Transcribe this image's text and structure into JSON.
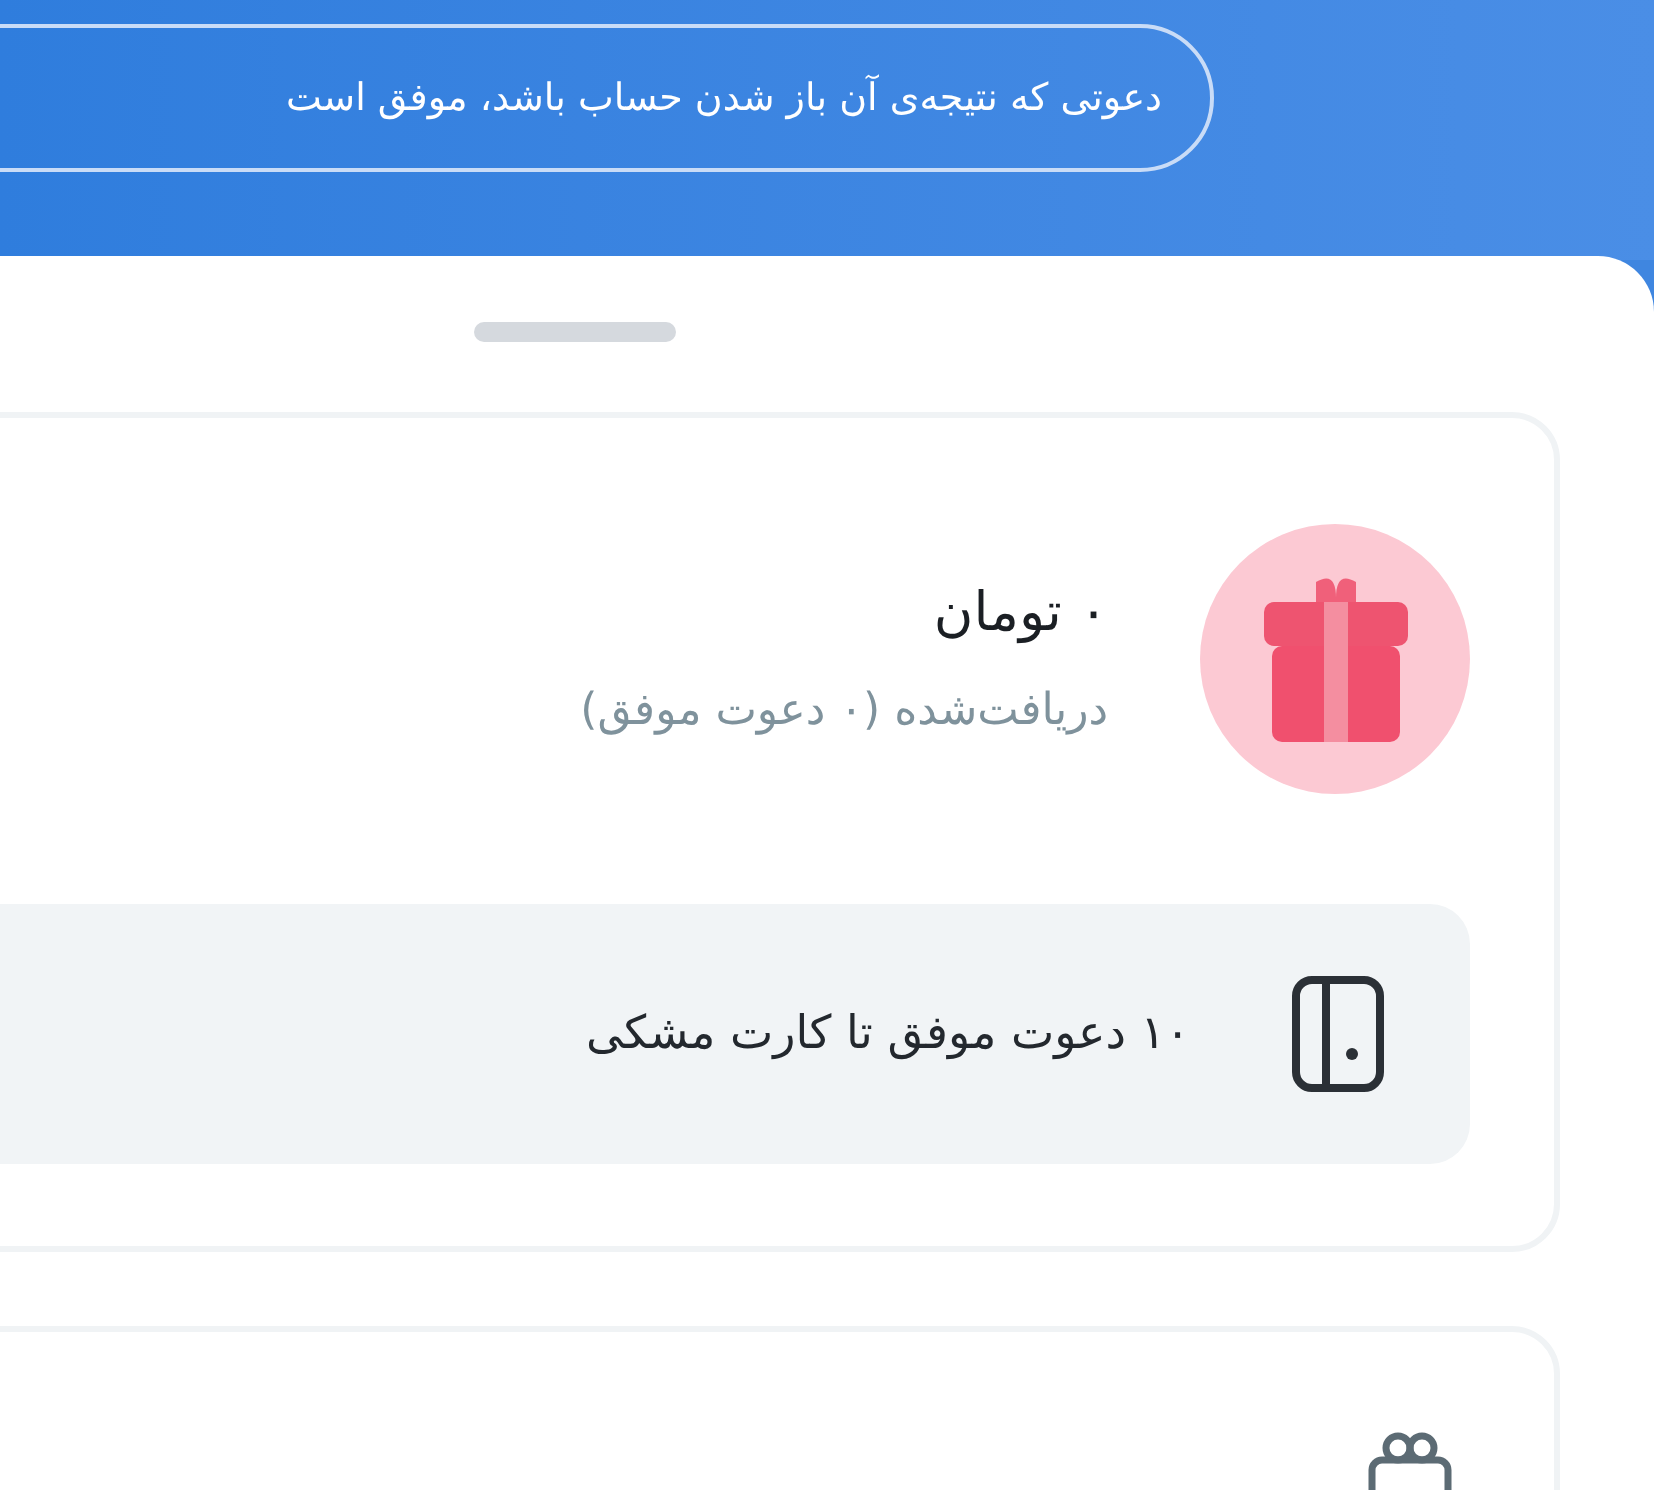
{
  "banner": {
    "text": "دعوتی که نتیجه‌ی آن باز شدن حساب باشد، موفق است"
  },
  "reward_card": {
    "amount": "۰ تومان",
    "subtitle": "دریافت‌شده (۰ دعوت موفق)",
    "milestone": "۱۰ دعوت موفق تا کارت مشکی"
  }
}
